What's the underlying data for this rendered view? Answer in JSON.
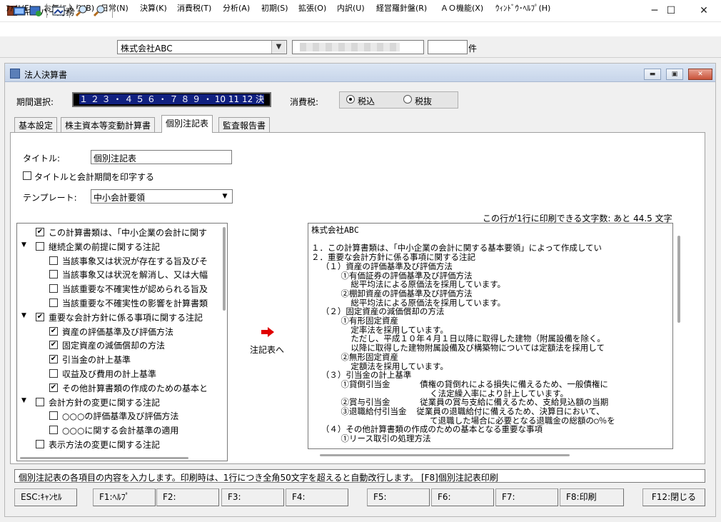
{
  "app": {
    "title": "キーパー財務"
  },
  "window_controls": {
    "minimize": "─",
    "maximize": "☐",
    "close": "✕"
  },
  "menu": [
    "ﾌｧｲﾙ(F)",
    "お気に入り(B)",
    "日常(N)",
    "決算(K)",
    "消費税(T)",
    "分析(A)",
    "初期(S)",
    "拡張(O)",
    "内訳(U)",
    "経営羅針盤(R)",
    "ＡＯ機能(X)",
    "ｳｨﾝﾄﾞｳ･ﾍﾙﾌﾟ(H)"
  ],
  "toolbar": {
    "company": "株式会社ABC",
    "count_unit": "件",
    "icons": [
      "open-icon",
      "refresh-icon",
      "image-icon",
      "zoom-in-icon",
      "zoom-out-icon"
    ]
  },
  "child": {
    "title": "法人決算書"
  },
  "period": {
    "label": "期間選択:",
    "value": "１ ２ ３ ・ ４ ５ ６ ・ ７ ８ ９ ・ 10 11 12 決"
  },
  "tax": {
    "label": "消費税:",
    "options": [
      "税込",
      "税抜"
    ],
    "selected": "税込"
  },
  "tabs": [
    "基本設定",
    "株主資本等変動計算書",
    "個別注記表",
    "監査報告書"
  ],
  "active_tab": "個別注記表",
  "form": {
    "title_label": "タイトル:",
    "title_value": "個別注記表",
    "print_label": "タイトルと会計期間を印字する",
    "print_checked": false,
    "template_label": "テンプレート:",
    "template_value": "中小会計要領"
  },
  "remaining": "この行が1行に印刷できる文字数: あと 44.5 文字",
  "tree": [
    {
      "level": 0,
      "arrow": "",
      "checked": true,
      "text": "この計算書類は、「中小企業の会計に関す"
    },
    {
      "level": 0,
      "arrow": "▲",
      "checked": false,
      "text": "継続企業の前提に関する注記"
    },
    {
      "level": 1,
      "arrow": "",
      "checked": false,
      "text": "当該事象又は状況が存在する旨及びそ"
    },
    {
      "level": 1,
      "arrow": "",
      "checked": false,
      "text": "当該事象又は状況を解消し、又は大幅"
    },
    {
      "level": 1,
      "arrow": "",
      "checked": false,
      "text": "当該重要な不確実性が認められる旨及"
    },
    {
      "level": 1,
      "arrow": "",
      "checked": false,
      "text": "当該重要な不確実性の影響を計算書類"
    },
    {
      "level": 0,
      "arrow": "▲",
      "checked": true,
      "text": "重要な会計方針に係る事項に関する注記"
    },
    {
      "level": 1,
      "arrow": "",
      "checked": true,
      "text": "資産の評価基準及び評価方法"
    },
    {
      "level": 1,
      "arrow": "",
      "checked": true,
      "text": "固定資産の減価償却の方法"
    },
    {
      "level": 1,
      "arrow": "",
      "checked": true,
      "text": "引当金の計上基準"
    },
    {
      "level": 1,
      "arrow": "",
      "checked": false,
      "text": "収益及び費用の計上基準"
    },
    {
      "level": 1,
      "arrow": "",
      "checked": true,
      "text": "その他計算書類の作成のための基本と"
    },
    {
      "level": 0,
      "arrow": "▲",
      "checked": false,
      "text": "会計方針の変更に関する注記"
    },
    {
      "level": 1,
      "arrow": "",
      "checked": false,
      "text": "○○○の評価基準及び評価方法"
    },
    {
      "level": 1,
      "arrow": "",
      "checked": false,
      "text": "○○○に関する会計基準の適用"
    },
    {
      "level": 0,
      "arrow": "",
      "checked": false,
      "text": "表示方法の変更に関する注記"
    }
  ],
  "arrow_label": "注記表へ",
  "preview": [
    "株式会社ABC",
    "",
    "１．この計算書類は、「中小企業の会計に関する基本要領」によって作成してい",
    "２．重要な会計方針に係る事項に関する注記",
    "  （１）資産の評価基準及び評価方法",
    "      ①有価証券の評価基準及び評価方法",
    "        総平均法による原価法を採用しています。",
    "      ②棚卸資産の評価基準及び評価方法",
    "        総平均法による原価法を採用しています。",
    "  （２）固定資産の減価償却の方法",
    "      ①有形固定資産",
    "        定率法を採用しています。",
    "        ただし、平成１０年４月１日以降に取得した建物（附属設備を除く。",
    "        以降に取得した建物附属設備及び構築物については定額法を採用して",
    "      ②無形固定資産",
    "        定額法を採用しています。",
    "  （３）引当金の計上基準",
    "      ①貸倒引当金      債権の貸倒れによる損失に備えるため、一般債権に",
    "                        く法定繰入率により計上しています。",
    "      ②賞与引当金      従業員の賞与支給に備えるため、支給見込額の当期",
    "      ③退職給付引当金  従業員の退職給付に備えるため、決算日において、",
    "                        て退職した場合に必要となる退職金の総額の○％を",
    "  （４）その他計算書類の作成のための基本となる重要な事項",
    "      ①リース取引の処理方法"
  ],
  "status": "個別注記表の各項目の内容を入力します。印刷時は、1行につき全角50文字を超えると自動改行します。 [F8]個別注記表印刷",
  "fkeys": [
    "ESC:ｷｬﾝｾﾙ",
    "F1:ﾍﾙﾌﾟ",
    "F2:",
    "F3:",
    "F4:",
    "F5:",
    "F6:",
    "F7:",
    "F8:印刷",
    "F12:閉じる"
  ]
}
